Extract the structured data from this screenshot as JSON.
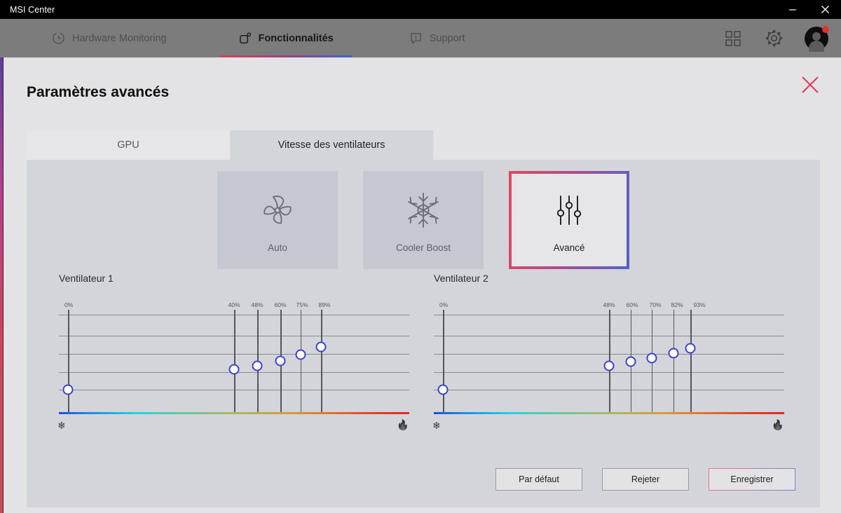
{
  "window": {
    "title": "MSI Center",
    "controls": [
      {
        "name": "minimize",
        "glyph": "minimize-icon"
      },
      {
        "name": "close",
        "glyph": "close-icon"
      }
    ]
  },
  "nav": {
    "items": [
      {
        "label": "Hardware Monitoring",
        "icon": "gauge-icon",
        "active": false
      },
      {
        "label": "Fonctionnalités",
        "icon": "feature-square-icon",
        "active": true
      },
      {
        "label": "Support",
        "icon": "support-bubble-icon",
        "active": false
      }
    ],
    "right_icons": [
      {
        "name": "apps-grid-icon"
      },
      {
        "name": "gear-icon"
      },
      {
        "name": "avatar"
      }
    ],
    "accent_gradient": [
      "#d4455a",
      "#9a3f87",
      "#3f63c9"
    ]
  },
  "dialog": {
    "title": "Paramètres avancés",
    "close_label": "×",
    "tabs": [
      {
        "label": "GPU",
        "active": false
      },
      {
        "label": "Vitesse des ventilateurs",
        "active": true
      }
    ],
    "modes": [
      {
        "label": "Auto",
        "icon": "fan-icon",
        "selected": false
      },
      {
        "label": "Cooler Boost",
        "icon": "snowflake-icon",
        "selected": false
      },
      {
        "label": "Avancé",
        "icon": "sliders-icon",
        "selected": true
      }
    ],
    "buttons": [
      {
        "label": "Par défaut",
        "accent": false
      },
      {
        "label": "Rejeter",
        "accent": false
      },
      {
        "label": "Enregistrer",
        "accent": true
      }
    ]
  },
  "chart_data": [
    {
      "type": "line",
      "title": "Ventilateur 1",
      "xlabel": "",
      "ylabel": "",
      "grid": true,
      "legend": "none",
      "cold_icon": "snowflake-icon",
      "hot_icon": "flame-icon",
      "tick_labels": [
        "0%",
        "40%",
        "48%",
        "60%",
        "75%",
        "89%"
      ],
      "tick_x_pct": [
        1.6,
        50.0,
        56.6,
        63.2,
        69.4,
        75.8
      ],
      "points": [
        {
          "label": "0%",
          "x_pct": 2.6,
          "y_pct": 78.0,
          "speed": 0
        },
        {
          "label": "40%",
          "x_pct": 50.0,
          "y_pct": 58.5,
          "speed": 40
        },
        {
          "label": "48%",
          "x_pct": 56.6,
          "y_pct": 55.0,
          "speed": 48
        },
        {
          "label": "60%",
          "x_pct": 63.2,
          "y_pct": 50.0,
          "speed": 60
        },
        {
          "label": "75%",
          "x_pct": 68.9,
          "y_pct": 43.5,
          "speed": 75
        },
        {
          "label": "89%",
          "x_pct": 74.8,
          "y_pct": 36.5,
          "speed": 89
        }
      ],
      "gridline_y_pct": [
        5,
        25,
        43,
        61,
        78
      ]
    },
    {
      "type": "line",
      "title": "Ventilateur 2",
      "xlabel": "",
      "ylabel": "",
      "grid": true,
      "legend": "none",
      "cold_icon": "snowflake-icon",
      "hot_icon": "flame-icon",
      "tick_labels": [
        "0%",
        "48%",
        "60%",
        "70%",
        "82%",
        "93%"
      ],
      "tick_x_pct": [
        1.6,
        50.0,
        56.6,
        63.2,
        69.4,
        75.8
      ],
      "points": [
        {
          "label": "0%",
          "x_pct": 2.6,
          "y_pct": 78.0,
          "speed": 0
        },
        {
          "label": "48%",
          "x_pct": 50.0,
          "y_pct": 55.0,
          "speed": 48
        },
        {
          "label": "60%",
          "x_pct": 56.1,
          "y_pct": 51.0,
          "speed": 60
        },
        {
          "label": "70%",
          "x_pct": 62.1,
          "y_pct": 47.0,
          "speed": 70
        },
        {
          "label": "82%",
          "x_pct": 68.3,
          "y_pct": 42.5,
          "speed": 82
        },
        {
          "label": "93%",
          "x_pct": 73.2,
          "y_pct": 37.5,
          "speed": 93
        }
      ],
      "gridline_y_pct": [
        5,
        25,
        43,
        61,
        78
      ]
    }
  ]
}
